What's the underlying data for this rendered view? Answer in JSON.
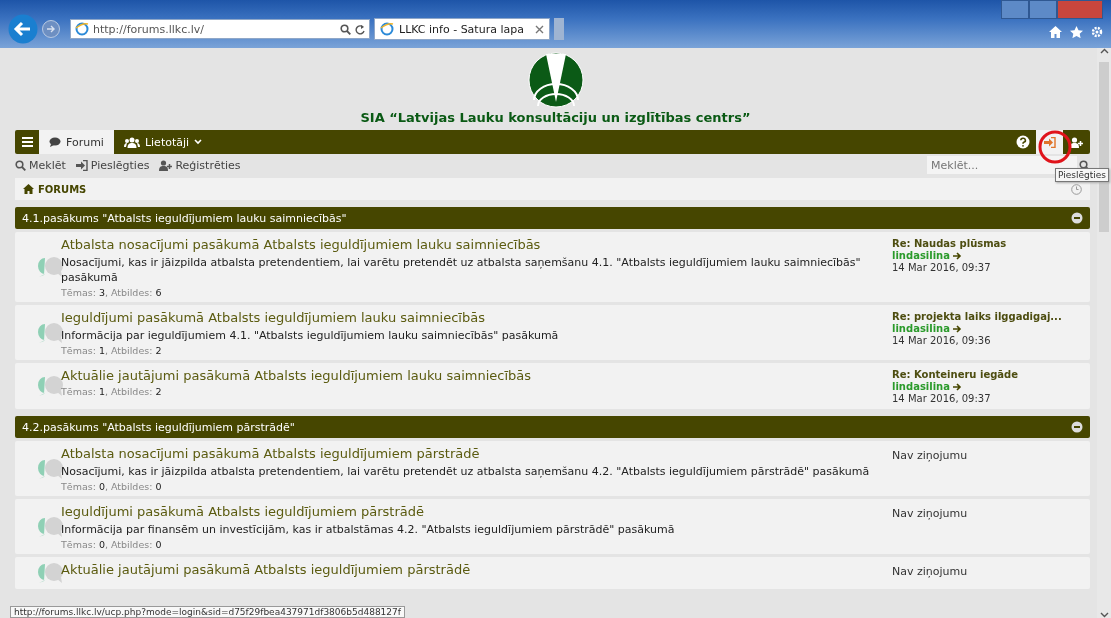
{
  "browser": {
    "address": "http://forums.llkc.lv/",
    "tab_title": "LLKC info - Satura lapa"
  },
  "header": {
    "title": "SIA “Latvijas Lauku konsultāciju un izglītības centrs”"
  },
  "navbar": {
    "tabs": [
      {
        "label": "Forumi",
        "kind": "forums",
        "selected": true
      },
      {
        "label": "Lietotāji",
        "kind": "users",
        "selected": false
      }
    ],
    "actions": [
      {
        "kind": "faq",
        "highlighted": false
      },
      {
        "kind": "login",
        "highlighted": true
      },
      {
        "kind": "register",
        "highlighted": false
      }
    ]
  },
  "quick_links": [
    {
      "label": "Meklēt",
      "kind": "search"
    },
    {
      "label": "Pieslēgties",
      "kind": "login"
    },
    {
      "label": "Reģistrēties",
      "kind": "register"
    }
  ],
  "search": {
    "placeholder": "Meklēt..."
  },
  "tooltip": "Pieslēgties",
  "breadcrumb": "FORUMS",
  "categories": [
    {
      "title": "4.1.pasākums \"Atbalsts ieguldījumiem lauku saimniecībās\"",
      "forums": [
        {
          "title": "Atbalsta nosacījumi pasākumā Atbalsts ieguldījumiem lauku saimniecībās",
          "description": "Nosacījumi, kas ir jāizpilda atbalsta pretendentiem, lai varētu pretendēt uz atbalsta saņemšanu 4.1. \"Atbalsts ieguldījumiem lauku saimniecībās\" pasākumā",
          "stats": "Tēmas: **3**, Atbildes: **6**",
          "last_post": {
            "title": "Re: Naudas plūsmas",
            "author": "lindasilina",
            "time": "14 Mar 2016, 09:37"
          }
        },
        {
          "title": "Ieguldījumi pasākumā Atbalsts ieguldījumiem lauku saimniecībās",
          "description": "Informācija par ieguldījumiem 4.1. \"Atbalsts ieguldījumiem lauku saimniecībās\" pasākumā",
          "stats": "Tēmas: **1**, Atbildes: **2**",
          "last_post": {
            "title": "Re: projekta laiks ilggadigaj...",
            "author": "lindasilina",
            "time": "14 Mar 2016, 09:36"
          }
        },
        {
          "title": "Aktuālie jautājumi pasākumā Atbalsts ieguldījumiem lauku saimniecībās",
          "stats": "Tēmas: **1**, Atbildes: **2**",
          "last_post": {
            "title": "Re: Konteineru iegāde",
            "author": "lindasilina",
            "time": "14 Mar 2016, 09:37"
          }
        }
      ]
    },
    {
      "title": "4.2.pasākums \"Atbalsts ieguldījumiem pārstrādē\"",
      "forums": [
        {
          "title": "Atbalsta nosacījumi pasākumā Atbalsts ieguldījumiem pārstrādē",
          "description": "Nosacījumi, kas ir jāizpilda atbalsta pretendentiem, lai varētu pretendēt uz atbalsta saņemšanu 4.2. \"Atbalsts ieguldījumiem pārstrādē\" pasākumā",
          "stats": "Tēmas: **0**, Atbildes: **0**",
          "no_posts": "Nav ziņojumu"
        },
        {
          "title": "Ieguldījumi pasākumā Atbalsts ieguldījumiem pārstrādē",
          "description": "Informācija par finansēm un investīcijām, kas ir atbalstāmas 4.2. \"Atbalsts ieguldījumiem pārstrādē\" pasākumā",
          "stats": "Tēmas: **0**, Atbildes: **0**",
          "no_posts": "Nav ziņojumu"
        },
        {
          "title": "Aktuālie jautājumi pasākumā Atbalsts ieguldījumiem pārstrādē",
          "no_posts": "Nav ziņojumu"
        }
      ]
    }
  ],
  "status_url": "http://forums.llkc.lv/ucp.php?mode=login&sid=d75f29fbea437971df3806b5d488127f"
}
